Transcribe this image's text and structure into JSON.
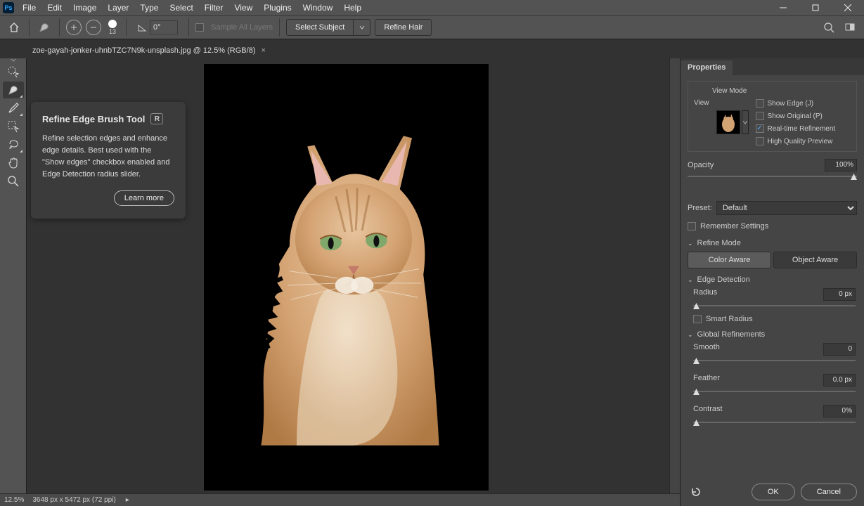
{
  "menu": {
    "items": [
      "File",
      "Edit",
      "Image",
      "Layer",
      "Type",
      "Select",
      "Filter",
      "View",
      "Plugins",
      "Window",
      "Help"
    ]
  },
  "options": {
    "brush_size": "13",
    "angle": "0°",
    "sample_all_layers": "Sample All Layers",
    "select_subject": "Select Subject",
    "refine_hair": "Refine Hair"
  },
  "doc_tab": {
    "title": "zoe-gayah-jonker-uhnbTZC7N9k-unsplash.jpg @ 12.5% (RGB/8)"
  },
  "tooltip": {
    "title": "Refine Edge Brush Tool",
    "key": "R",
    "desc": "Refine selection edges and enhance edge details. Best used with the \"Show edges\" checkbox enabled and Edge Detection radius slider.",
    "learn": "Learn more"
  },
  "panel": {
    "tab": "Properties",
    "view_mode_title": "View Mode",
    "view_label": "View",
    "show_edge": "Show Edge (J)",
    "show_original": "Show Original (P)",
    "realtime": "Real-time Refinement",
    "hq_preview": "High Quality Preview",
    "opacity_label": "Opacity",
    "opacity_value": "100%",
    "preset_label": "Preset:",
    "preset_value": "Default",
    "remember": "Remember Settings",
    "refine_mode": "Refine Mode",
    "color_aware": "Color Aware",
    "object_aware": "Object Aware",
    "edge_detection": "Edge Detection",
    "radius_label": "Radius",
    "radius_value": "0 px",
    "smart_radius": "Smart Radius",
    "global_refinements": "Global Refinements",
    "smooth_label": "Smooth",
    "smooth_value": "0",
    "feather_label": "Feather",
    "feather_value": "0.0 px",
    "contrast_label": "Contrast",
    "contrast_value": "0%",
    "ok": "OK",
    "cancel": "Cancel"
  },
  "status": {
    "zoom": "12.5%",
    "dims": "3648 px x 5472 px (72 ppi)"
  }
}
